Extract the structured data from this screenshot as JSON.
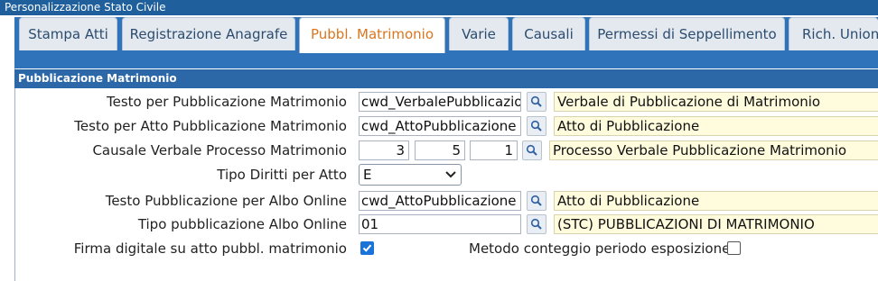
{
  "window": {
    "title": "Personalizzazione Stato Civile"
  },
  "tabs": [
    {
      "label": "Stampa Atti",
      "active": false
    },
    {
      "label": "Registrazione Anagrafe",
      "active": false
    },
    {
      "label": "Pubbl. Matrimonio",
      "active": true
    },
    {
      "label": "Varie",
      "active": false
    },
    {
      "label": "Causali",
      "active": false
    },
    {
      "label": "Permessi di Seppellimento",
      "active": false
    },
    {
      "label": "Rich. Unione",
      "active": false
    }
  ],
  "section": {
    "title": "Pubblicazione Matrimonio"
  },
  "form": {
    "testo_pubblicazione": {
      "label": "Testo per Pubblicazione Matrimonio",
      "value": "cwd_VerbalePubblicazione",
      "description": "Verbale di Pubblicazione di Matrimonio"
    },
    "testo_atto": {
      "label": "Testo per Atto Pubblicazione Matrimonio",
      "value": "cwd_AttoPubblicazione",
      "description": "Atto di Pubblicazione"
    },
    "causale_verbale": {
      "label": "Causale Verbale Processo Matrimonio",
      "v1": "3",
      "v2": "5",
      "v3": "1",
      "description": "Processo Verbale Pubblicazione Matrimonio"
    },
    "tipo_diritti": {
      "label": "Tipo Diritti per Atto",
      "selected": "E"
    },
    "testo_albo": {
      "label": "Testo Pubblicazione per Albo Online",
      "value": "cwd_AttoPubblicazione",
      "description": "Atto di Pubblicazione"
    },
    "tipo_albo": {
      "label": "Tipo pubblicazione Albo Online",
      "value": "01",
      "description": "(STC) PUBBLICAZIONI DI MATRIMONIO"
    },
    "firma_digitale": {
      "label": "Firma digitale su atto pubbl. matrimonio",
      "checked": true
    },
    "metodo_conteggio": {
      "label": "Metodo conteggio periodo esposizione",
      "checked": false
    }
  },
  "colors": {
    "titlebar": "#1f5f9c",
    "tabstrip": "#2f73ba",
    "active_tab_text": "#d9761e",
    "description_bg": "#fffbdd",
    "checkbox_on": "#1a73d9"
  }
}
